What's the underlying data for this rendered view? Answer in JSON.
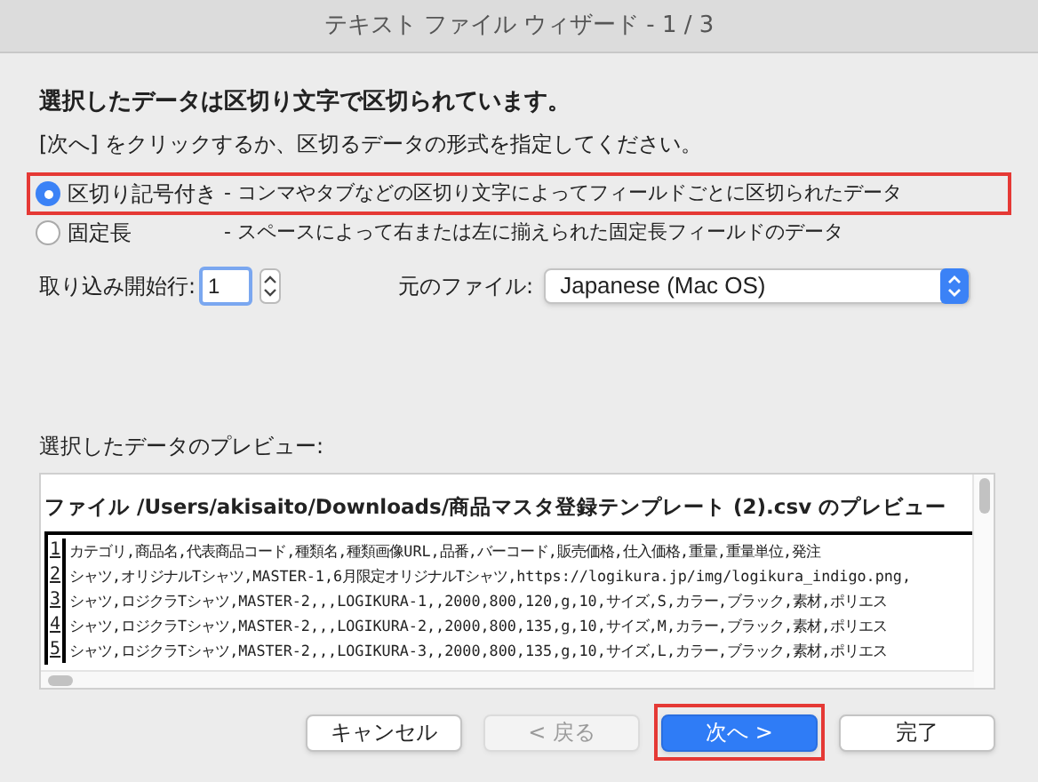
{
  "window": {
    "title": "テキスト ファイル ウィザード - 1 / 3"
  },
  "heading": "選択したデータは区切り文字で区切られています。",
  "instruction": "[次へ] をクリックするか、区切るデータの形式を指定してください。",
  "format_options": [
    {
      "label": "区切り記号付き",
      "description": "- コンマやタブなどの区切り文字によってフィールドごとに区切られたデータ",
      "selected": true,
      "highlighted": true
    },
    {
      "label": "固定長",
      "description": "- スペースによって右または左に揃えられた固定長フィールドのデータ",
      "selected": false,
      "highlighted": false
    }
  ],
  "start_row": {
    "label": "取り込み開始行:",
    "value": "1"
  },
  "origin": {
    "label": "元のファイル:",
    "value": "Japanese (Mac OS)"
  },
  "preview": {
    "label": "選択したデータのプレビュー:",
    "title": "ファイル /Users/akisaito/Downloads/商品マスタ登録テンプレート (2).csv のプレビュー",
    "rows": [
      {
        "number": "1",
        "text": "カテゴリ,商品名,代表商品コード,種類名,種類画像URL,品番,バーコード,販売価格,仕入価格,重量,重量単位,発注"
      },
      {
        "number": "2",
        "text": "シャツ,オリジナルTシャツ,MASTER-1,6月限定オリジナルTシャツ,https://logikura.jp/img/logikura_indigo.png,"
      },
      {
        "number": "3",
        "text": "シャツ,ロジクラTシャツ,MASTER-2,,,LOGIKURA-1,,2000,800,120,g,10,サイズ,S,カラー,ブラック,素材,ポリエス"
      },
      {
        "number": "4",
        "text": "シャツ,ロジクラTシャツ,MASTER-2,,,LOGIKURA-2,,2000,800,135,g,10,サイズ,M,カラー,ブラック,素材,ポリエス"
      },
      {
        "number": "5",
        "text": "シャツ,ロジクラTシャツ,MASTER-2,,,LOGIKURA-3,,2000,800,135,g,10,サイズ,L,カラー,ブラック,素材,ポリエス"
      }
    ]
  },
  "buttons": [
    {
      "label": "キャンセル",
      "kind": "normal",
      "disabled": false,
      "highlighted": false
    },
    {
      "label": "< 戻る",
      "kind": "normal",
      "disabled": true,
      "highlighted": false
    },
    {
      "label": "次へ >",
      "kind": "default",
      "disabled": false,
      "highlighted": true
    },
    {
      "label": "完了",
      "kind": "normal",
      "disabled": false,
      "highlighted": false
    }
  ]
}
